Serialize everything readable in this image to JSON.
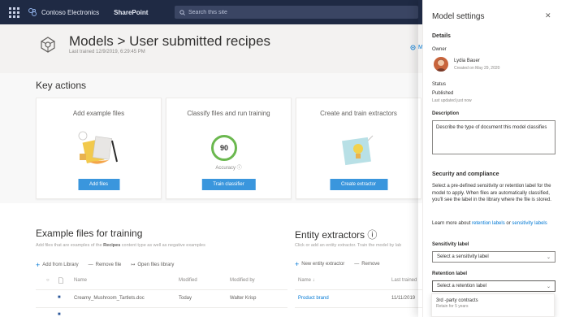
{
  "suitebar": {
    "org_name": "Contoso Electronics",
    "app_name": "SharePoint",
    "search_placeholder": "Search this site"
  },
  "header": {
    "title": "Models > User submitted recipes",
    "subtitle": "Last trained 12/9/2019, 6:29:45 PM",
    "right_link": "M"
  },
  "key_actions": {
    "heading": "Key actions",
    "cards": [
      {
        "title": "Add example files",
        "button": "Add files"
      },
      {
        "title": "Classify files and run training",
        "button": "Train classifier",
        "accuracy_value": "90",
        "accuracy_label": "Accuracy ⓘ"
      },
      {
        "title": "Create and train extractors",
        "button": "Create extractor"
      }
    ]
  },
  "example_files": {
    "heading": "Example files for training",
    "description_pre": "Add files that are examples of the ",
    "description_bold": "Recipes",
    "description_post": " content type as well as negative examples",
    "toolbar": [
      "Add from Library",
      "Remove file",
      "Open files library"
    ],
    "columns": [
      "Name",
      "Modified",
      "Modified by"
    ],
    "rows": [
      {
        "name": "Creamy_Mushroom_Tartlets.doc",
        "modified": "Today",
        "modified_by": "Walter Krisp"
      }
    ]
  },
  "entity_extractors": {
    "heading": "Entity extractors ⓘ",
    "description": "Click or add an entity extractor. Train the model by lab",
    "toolbar": [
      "New entity extractor",
      "Remove"
    ],
    "columns": [
      "Name ↓",
      "Last trained"
    ],
    "rows": [
      {
        "name": "Product brand",
        "last_trained": "11/11/2019"
      }
    ]
  },
  "panel": {
    "title": "Model settings",
    "close": "✕",
    "details_heading": "Details",
    "owner_label": "Owner",
    "owner_name": "Lydia Bauer",
    "owner_created": "Created on May 29, 2020",
    "status_label": "Status",
    "status_value": "Published",
    "status_updated": "Last updated just now",
    "description_label": "Description",
    "description_value": "Describe the type of document this model classifies",
    "security_heading": "Security and compliance",
    "security_text": "Select a pre-defined sensitivity or retention label for the model to apply. When files are automatically classified, you'll see the label in the library where the file is stored.",
    "learn_more_pre": "Learn more about ",
    "learn_more_link1": "retention labels",
    "learn_more_mid": " or ",
    "learn_more_link2": "sensitivity labels",
    "sensitivity_label": "Sensitivity label",
    "sensitivity_placeholder": "Select a sensitivity label",
    "retention_label": "Retention label",
    "retention_placeholder": "Select a retention label",
    "dropdown_option": "3rd -party contracts",
    "dropdown_option_sub": "Retain for 5 years"
  },
  "colors": {
    "suitebar": "#1f2a44",
    "accent": "#0078d4",
    "button": "#3a96dd",
    "accuracy_ring": "#6bb84f"
  }
}
